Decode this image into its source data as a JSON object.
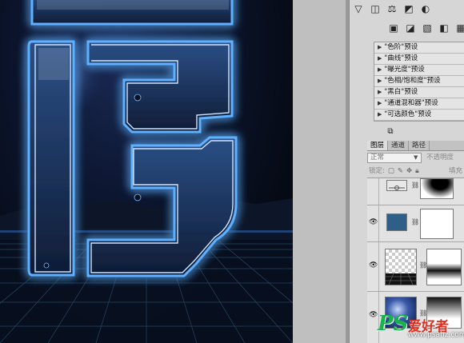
{
  "tools": {
    "row1": [
      "levels-icon",
      "curves-icon",
      "balance-icon",
      "gradient-icon",
      "adjust-circle-icon"
    ],
    "row2": [
      "mask-icon",
      "pen-icon",
      "fill-icon",
      "selective-icon",
      "fx-icon"
    ]
  },
  "adjustments": {
    "items": [
      {
        "label": "\"色阶\"预设"
      },
      {
        "label": "\"曲线\"预设"
      },
      {
        "label": "\"曝光度\"预设"
      },
      {
        "label": "\"色相/饱和度\"预设"
      },
      {
        "label": "\"黑白\"预设"
      },
      {
        "label": "\"通道混和器\"预设"
      },
      {
        "label": "\"可选颜色\"预设"
      }
    ]
  },
  "layers_panel": {
    "tabs": [
      {
        "label": "图层",
        "active": true
      },
      {
        "label": "通道",
        "active": false
      },
      {
        "label": "路径",
        "active": false
      }
    ],
    "blend_mode": "正常",
    "opacity_label": "不透明度",
    "lock_label": "锁定:",
    "fill_label": "填充",
    "layers": [
      {
        "visible": false,
        "name": ""
      },
      {
        "visible": true,
        "name": ""
      },
      {
        "visible": true,
        "name": ""
      },
      {
        "visible": true,
        "name": ""
      }
    ]
  },
  "watermark": {
    "ps": "PS",
    "cn": "爱好者",
    "url": "www.psahz.com"
  },
  "colors": {
    "neon_blue": "#2a7dff",
    "neon_core": "#cfe6ff",
    "canvas_bg": "#060a14",
    "solid_swatch": "#2f5f88"
  }
}
